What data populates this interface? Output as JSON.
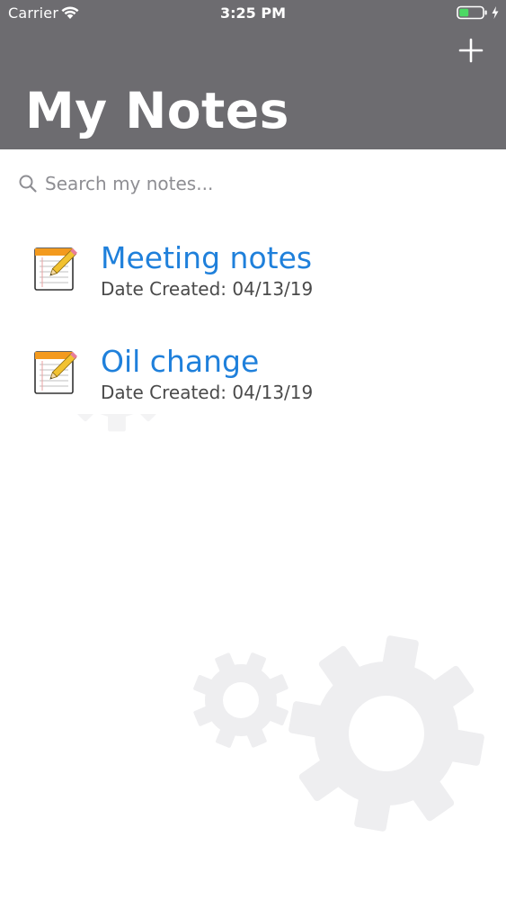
{
  "status_bar": {
    "carrier": "Carrier",
    "time": "3:25 PM",
    "battery_color": "#4cd964",
    "wifi_icon": "wifi-icon",
    "battery_icon": "battery-icon",
    "charging_icon": "bolt-icon"
  },
  "header": {
    "title": "My Notes",
    "add_icon": "plus-icon",
    "background_color": "#6d6c70"
  },
  "search": {
    "placeholder": "Search my notes...",
    "value": "",
    "icon": "search-icon"
  },
  "notes": [
    {
      "title": "Meeting notes",
      "date": "Date Created: 04/13/19",
      "icon": "notepad-pencil-icon"
    },
    {
      "title": "Oil change",
      "date": "Date Created: 04/13/19",
      "icon": "notepad-pencil-icon"
    }
  ],
  "colors": {
    "note_title": "#1f80db",
    "note_date": "#4a4a4a",
    "gear_watermark": "#eeeef0"
  }
}
